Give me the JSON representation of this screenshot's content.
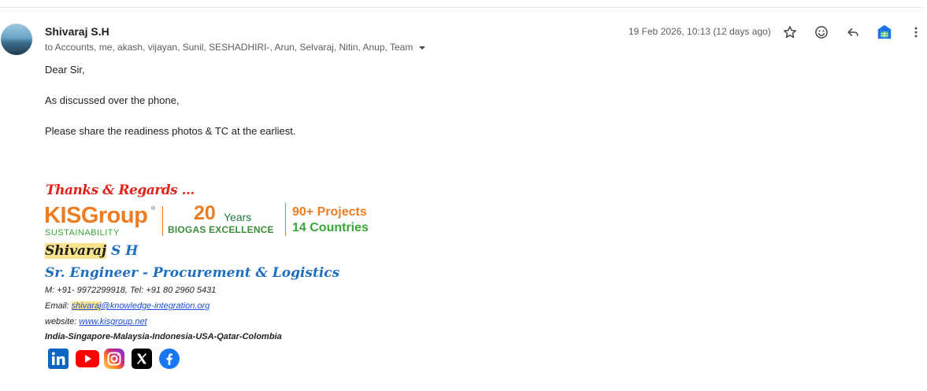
{
  "email": {
    "sender_name": "Shivaraj S.H",
    "recipients": "to Accounts, me, akash, vijayan, Sunil, SESHADHIRI-, Arun, Selvaraj, Nitin, Anup, Team",
    "date": "19 Feb 2026, 10:13 (12 days ago)",
    "body": {
      "greeting": "Dear Sir,",
      "line1": "As discussed over the phone,",
      "line2": "Please share the readiness photos & TC at the earliest."
    }
  },
  "signature": {
    "thanks": "Thanks & Regards ...",
    "logo": {
      "brand": "KISGroup",
      "sustainability": "SUSTAINABILITY",
      "years_num": "20",
      "years_word": "Years",
      "biogas": "BIOGAS EXCELLENCE",
      "projects": "90+ Projects",
      "countries": "14 Countries"
    },
    "name_first": "Shivaraj",
    "name_rest": " S H",
    "title": "Sr. Engineer - Procurement & Logistics",
    "phone": "M: +91- 9972299918, Tel: +91 80 2960 5431",
    "email_label": "Email: ",
    "email_user": "shivaraj",
    "email_domain": "@knowledge-integration.org",
    "website_label": "website: ",
    "website": "www.kisgroup.net",
    "countries": "India-Singapore-Malaysia-Indonesia-USA-Qatar-Colombia"
  },
  "colors": {
    "accent_blue": "#1f6fbf",
    "orange": "#ed7d22",
    "green": "#3aa637",
    "highlight": "#fbe38e"
  }
}
